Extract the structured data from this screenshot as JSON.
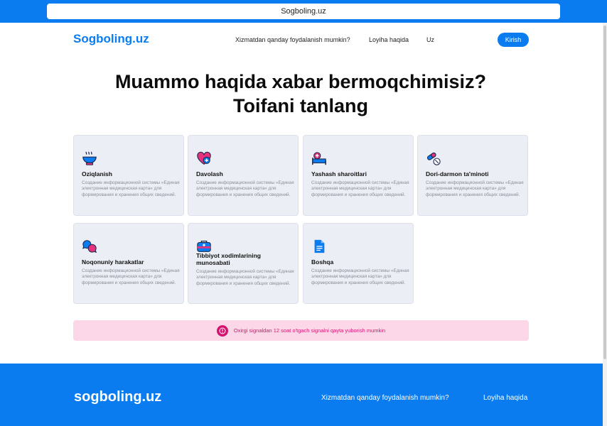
{
  "browser": {
    "url": "Sogboling.uz"
  },
  "header": {
    "logo": "Sogboling.uz",
    "nav": [
      "Xizmatdan qanday foydalanish mumkin?",
      "Loyiha haqida",
      "Uz"
    ],
    "login_label": "Kirish"
  },
  "main": {
    "title_line1": "Muammo haqida xabar bermoqchimisiz?",
    "title_line2": "Toifani tanlang",
    "categories": [
      {
        "title": "Oziqlanish",
        "icon": "food-bowl-icon",
        "description": "Создание информационной системы «Единая электронная медицинская карта» для формирования и хранения общих сведений."
      },
      {
        "title": "Davolash",
        "icon": "heart-care-icon",
        "description": "Создание информационной системы «Единая электронная медицинская карта» для формирования и хранения общих сведений."
      },
      {
        "title": "Yashash sharoitlari",
        "icon": "hospital-bed-icon",
        "description": "Создание информационной системы «Единая электронная медицинская карта» для формирования и хранения общих сведений."
      },
      {
        "title": "Dori-darmon ta'minoti",
        "icon": "pills-icon",
        "description": "Создание информационной системы «Единая электронная медицинская карта» для формирования и хранения общих сведений."
      },
      {
        "title": "Noqonuniy harakatlar",
        "icon": "speech-bubbles-icon",
        "description": "Создание информационной системы «Единая электронная медицинская карта» для формирования и хранения общих сведений."
      },
      {
        "title": "Tibbiyot xodimlarining munosabati",
        "icon": "medical-kit-icon",
        "description": "Создание информационной системы «Единая электронная медицинская карта» для формирования и хранения общих сведений."
      },
      {
        "title": "Boshqa",
        "icon": "document-icon",
        "description": "Создание информационной системы «Единая электронная медицинская карта» для формирования и хранения общих сведений."
      }
    ],
    "notice": "Oxirgi signaldan 12 soat o'tgach signalni qayta yuborish mumkin"
  },
  "footer": {
    "logo": "sogboling.uz",
    "links": [
      "Xizmatdan qanday foydalanish mumkin?",
      "Loyiha haqida"
    ]
  },
  "colors": {
    "brand": "#0a7cf0",
    "notice_bg": "#fcd7e8",
    "notice_text": "#d3136f",
    "card_bg": "#eceef5"
  }
}
